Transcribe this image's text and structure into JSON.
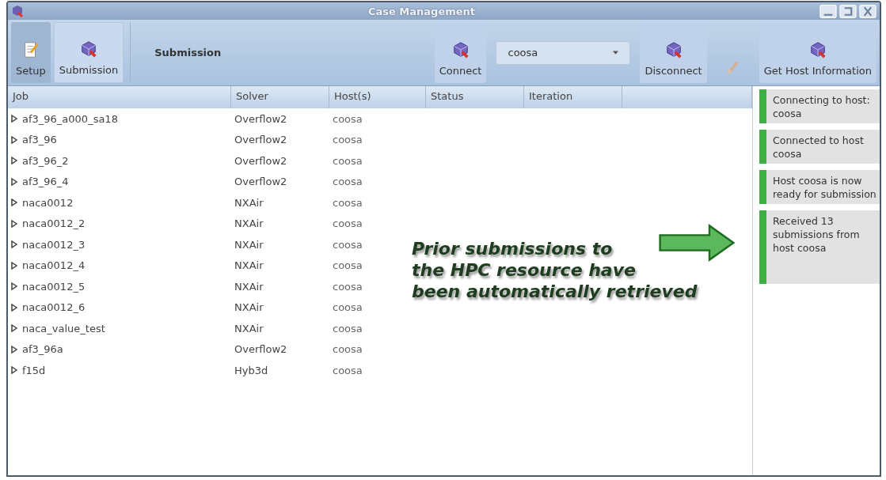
{
  "window": {
    "title": "Case Management"
  },
  "toolbar": [
    {
      "kind": "tab",
      "label": "Setup",
      "selected": false
    },
    {
      "kind": "tab",
      "label": "Submission",
      "selected": true
    },
    {
      "kind": "heading",
      "label": "Submission"
    },
    {
      "kind": "button",
      "label": "Connect",
      "disabled": false
    },
    {
      "kind": "combo",
      "value": "coosa"
    },
    {
      "kind": "button",
      "label": "Disconnect",
      "disabled": false
    },
    {
      "kind": "button",
      "disabled": true
    },
    {
      "kind": "button",
      "label": "Get Host Information",
      "disabled": false
    }
  ],
  "table": {
    "columns": [
      "Job",
      "Solver",
      "Host(s)",
      "Status",
      "Iteration"
    ],
    "rows": [
      {
        "job": "af3_96_a000_sa18",
        "solver": "Overflow2",
        "host": "coosa"
      },
      {
        "job": "af3_96",
        "solver": "Overflow2",
        "host": "coosa"
      },
      {
        "job": "af3_96_2",
        "solver": "Overflow2",
        "host": "coosa"
      },
      {
        "job": "af3_96_4",
        "solver": "Overflow2",
        "host": "coosa"
      },
      {
        "job": "naca0012",
        "solver": "NXAir",
        "host": "coosa"
      },
      {
        "job": "naca0012_2",
        "solver": "NXAir",
        "host": "coosa"
      },
      {
        "job": "naca0012_3",
        "solver": "NXAir",
        "host": "coosa"
      },
      {
        "job": "naca0012_4",
        "solver": "NXAir",
        "host": "coosa"
      },
      {
        "job": "naca0012_5",
        "solver": "NXAir",
        "host": "coosa"
      },
      {
        "job": "naca0012_6",
        "solver": "NXAir",
        "host": "coosa"
      },
      {
        "job": "naca_value_test",
        "solver": "NXAir",
        "host": "coosa"
      },
      {
        "job": "af3_96a",
        "solver": "Overflow2",
        "host": "coosa"
      },
      {
        "job": "f15d",
        "solver": "Hyb3d",
        "host": "coosa"
      }
    ]
  },
  "annotation": {
    "lines": [
      "Prior submissions to",
      "the HPC resource have",
      "been automatically retrieved"
    ]
  },
  "messages": [
    {
      "text": "Connecting to host: coosa"
    },
    {
      "text": "Connected to host coosa"
    },
    {
      "text": "Host coosa is now ready for submission"
    },
    {
      "text": "Received 13 submissions from host coosa"
    }
  ]
}
